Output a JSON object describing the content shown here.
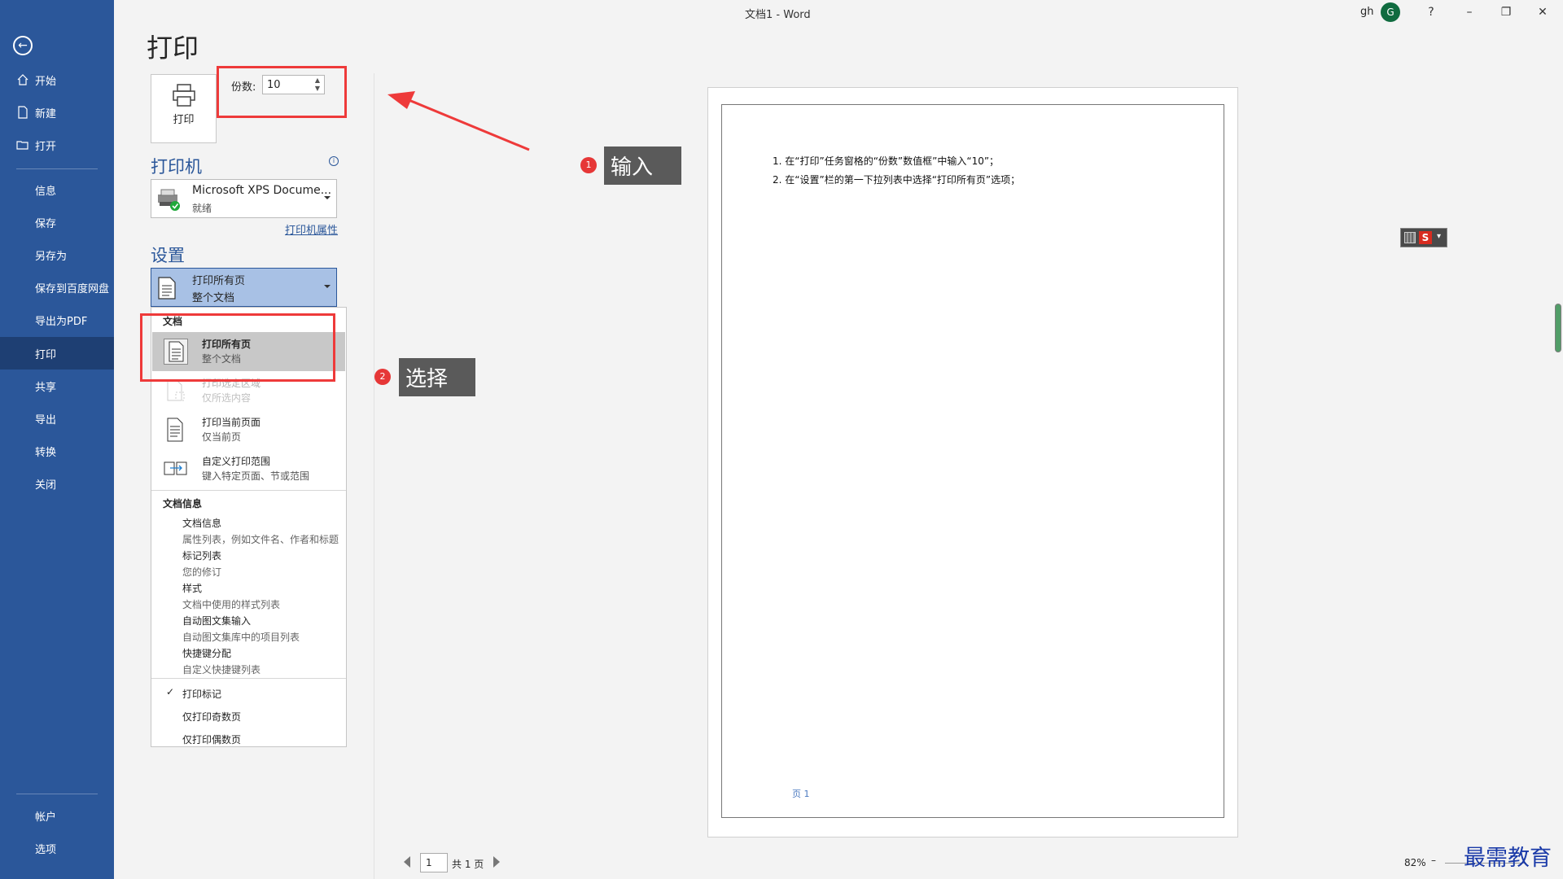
{
  "window": {
    "title": "文档1 - Word",
    "user_name": "gh",
    "avatar_initial": "G",
    "help": "?",
    "minimize": "–",
    "restore": "❐",
    "close": "✕"
  },
  "sidebar": {
    "back_glyph": "←",
    "items": [
      {
        "label": "开始",
        "icon": "home-icon"
      },
      {
        "label": "新建",
        "icon": "new-document-icon"
      },
      {
        "label": "打开",
        "icon": "open-folder-icon"
      },
      {
        "label": "信息"
      },
      {
        "label": "保存"
      },
      {
        "label": "另存为"
      },
      {
        "label": "保存到百度网盘"
      },
      {
        "label": "导出为PDF"
      },
      {
        "label": "打印",
        "active": true
      },
      {
        "label": "共享"
      },
      {
        "label": "导出"
      },
      {
        "label": "转换"
      },
      {
        "label": "关闭"
      }
    ],
    "bottom_items": [
      {
        "label": "帐户"
      },
      {
        "label": "选项"
      }
    ]
  },
  "print": {
    "page_title": "打印",
    "print_button_label": "打印",
    "copies_label": "份数:",
    "copies_value": "10",
    "printer_section": "打印机",
    "printer_name": "Microsoft XPS Docume...",
    "printer_status": "就绪",
    "printer_properties": "打印机属性",
    "settings_section": "设置",
    "pages_selected_title": "打印所有页",
    "pages_selected_sub": "整个文档"
  },
  "pages_menu": {
    "group_document": "文档",
    "options": [
      {
        "title": "打印所有页",
        "sub": "整个文档",
        "state": "selected"
      },
      {
        "title": "打印选定区域",
        "sub": "仅所选内容",
        "state": "disabled"
      },
      {
        "title": "打印当前页面",
        "sub": "仅当前页",
        "state": "normal"
      },
      {
        "title": "自定义打印范围",
        "sub": "键入特定页面、节或范围",
        "state": "normal"
      }
    ],
    "group_info": "文档信息",
    "info_items": [
      {
        "title": "文档信息",
        "sub": "属性列表，例如文件名、作者和标题"
      },
      {
        "title": "标记列表",
        "sub": "您的修订"
      },
      {
        "title": "样式",
        "sub": "文档中使用的样式列表"
      },
      {
        "title": "自动图文集输入",
        "sub": "自动图文集库中的项目列表"
      },
      {
        "title": "快捷键分配",
        "sub": "自定义快捷键列表"
      }
    ],
    "toggles": [
      {
        "label": "打印标记",
        "checked": true
      },
      {
        "label": "仅打印奇数页",
        "checked": false
      },
      {
        "label": "仅打印偶数页",
        "checked": false
      }
    ],
    "check_glyph": "✓"
  },
  "annotations": {
    "callout1": {
      "number": "1",
      "text": "输入"
    },
    "callout2": {
      "number": "2",
      "text": "选择"
    },
    "arrow_color": "#ee3a3a"
  },
  "preview": {
    "lines": [
      "1.  在“打印”任务窗格的“份数”数值框”中输入“10”；",
      "2.  在“设置”栏的第一下拉列表中选择“打印所有页”选项；"
    ],
    "footer": "页 1"
  },
  "bottom": {
    "page_current": "1",
    "page_total": "共 1 页",
    "zoom": "82%",
    "zoom_minus": "–"
  },
  "watermark": "最需教育",
  "colors": {
    "sidebar": "#2b579a",
    "accent": "#2b579a",
    "annotation_red": "#ee3a3a"
  }
}
